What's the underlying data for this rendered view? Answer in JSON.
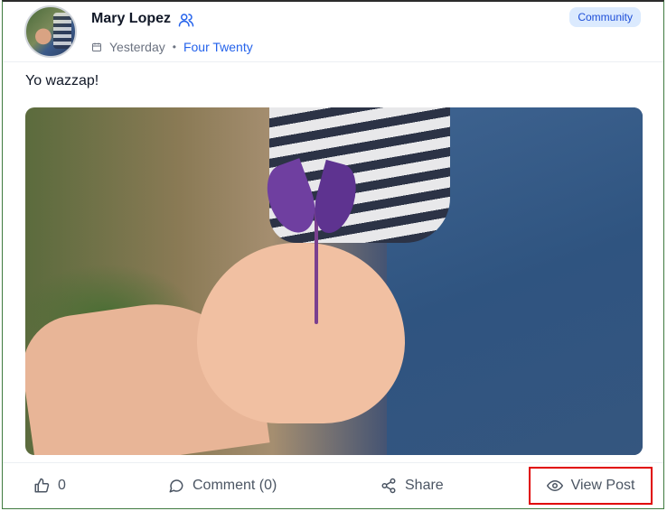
{
  "post": {
    "author_name": "Mary Lopez",
    "time": "Yesterday",
    "group": "Four Twenty",
    "badge": "Community",
    "text": "Yo wazzap!",
    "image_description": "A child's hand holding a purple sprout offered to an adult hand"
  },
  "actions": {
    "likes_count": "0",
    "comment_label": "Comment (0)",
    "share_label": "Share",
    "view_label": "View Post"
  },
  "icons": {
    "author_icon": "users-icon",
    "time_icon": "calendar-icon",
    "like_icon": "thumbs-up-icon",
    "comment_icon": "comment-icon",
    "share_icon": "share-icon",
    "view_icon": "eye-icon"
  },
  "colors": {
    "link": "#2563eb",
    "badge_bg": "#dbeafe",
    "badge_text": "#1d4ed8",
    "highlight": "#e00000"
  }
}
